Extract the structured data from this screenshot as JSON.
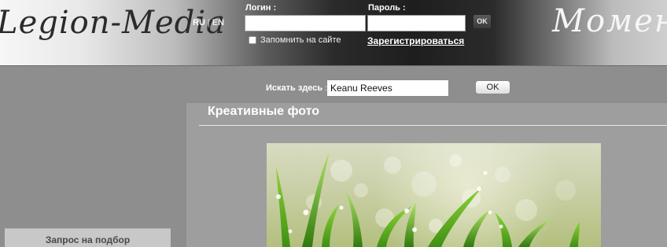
{
  "header": {
    "logo": "Legion-Media",
    "languages": {
      "ru": "RU",
      "separator": "|",
      "en": "EN"
    },
    "login_label": "Логин :",
    "login_value": "",
    "password_label": "Пароль :",
    "password_value": "",
    "ok_label": "OK",
    "remember_label": "Запомнить на сайте",
    "register_link": "Зарегистрироваться",
    "slogan": "Момент и"
  },
  "search": {
    "label": "Искать здесь :",
    "value": "Keanu Reeves",
    "ok_label": "OK"
  },
  "sidebar": {
    "request_button": "Запрос на подбор"
  },
  "main": {
    "section_title": "Креативные фото",
    "photo_subject": "dewy-grass-photo"
  },
  "colors": {
    "page_background": "#8e8e8e",
    "panel_background": "#9e9e9e",
    "header_dark": "#1e1e1e"
  }
}
